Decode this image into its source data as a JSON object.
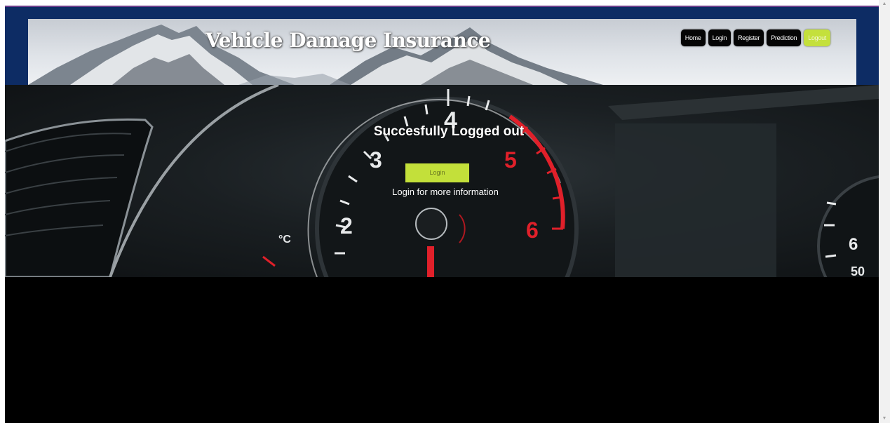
{
  "header": {
    "title": "Vehicle Damage Insurance",
    "nav": [
      "Home",
      "Login",
      "Register",
      "Prediction",
      "Logout"
    ]
  },
  "hero": {
    "message_title": "Succesfully Logged out",
    "login_button": "Login",
    "message_sub": "Login for more information",
    "gauge_numbers": [
      "2",
      "3",
      "4",
      "5",
      "6"
    ],
    "side_gauge_numbers": [
      "6",
      "50"
    ],
    "temp_label": "°C"
  },
  "colors": {
    "header_bg": "#0d2c64",
    "accent": "#c4e03c",
    "nav_bg": "#050505",
    "gauge_red": "#e0202a"
  },
  "icons": [
    "scroll-up-arrow-icon",
    "scroll-down-arrow-icon"
  ]
}
